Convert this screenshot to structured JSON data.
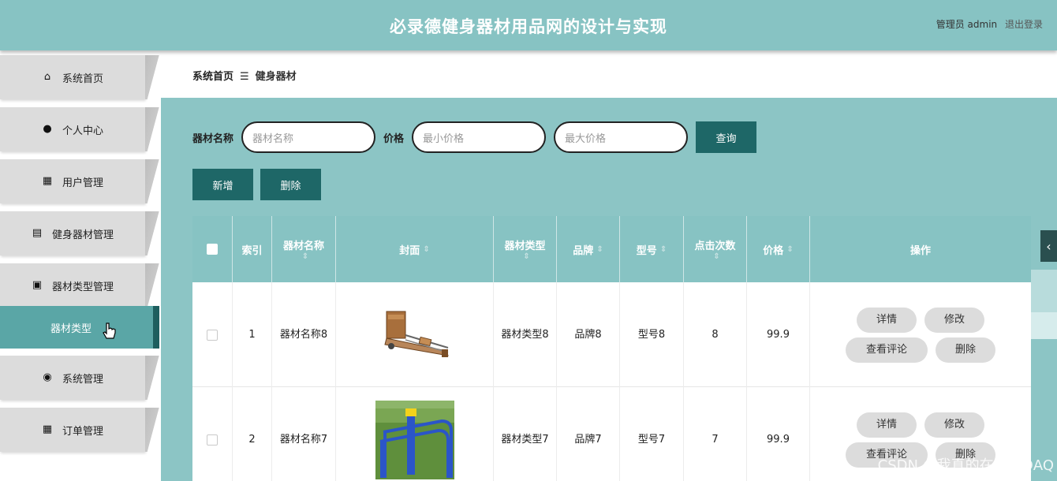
{
  "header": {
    "title": "必录德健身器材用品网的设计与实现",
    "role": "管理员 admin",
    "logout": "退出登录"
  },
  "sidebar": {
    "items": [
      {
        "label": "系统首页",
        "icon": "home-icon",
        "glyph": "⌂"
      },
      {
        "label": "个人中心",
        "icon": "person-icon",
        "glyph": "●"
      },
      {
        "label": "用户管理",
        "icon": "grid-icon",
        "glyph": "▦"
      },
      {
        "label": "健身器材管理",
        "icon": "chat-icon",
        "glyph": "▤"
      },
      {
        "label": "器材类型管理",
        "icon": "clipboard-icon",
        "glyph": "▣"
      },
      {
        "label": "系统管理",
        "icon": "bulb-icon",
        "glyph": "◉"
      },
      {
        "label": "订单管理",
        "icon": "grid-icon",
        "glyph": "▦"
      }
    ],
    "active_sub": "器材类型"
  },
  "breadcrumb": {
    "home": "系统首页",
    "separator": "☰",
    "current": "健身器材"
  },
  "search": {
    "name_label": "器材名称",
    "name_placeholder": "器材名称",
    "price_label": "价格",
    "min_placeholder": "最小价格",
    "max_placeholder": "最大价格",
    "query_button": "查询"
  },
  "actions": {
    "add": "新增",
    "delete": "删除"
  },
  "table": {
    "headers": {
      "index": "索引",
      "name": "器材名称",
      "cover": "封面",
      "type": "器材类型",
      "brand": "品牌",
      "model": "型号",
      "clicks": "点击次数",
      "price": "价格",
      "ops": "操作"
    },
    "rows": [
      {
        "index": "1",
        "name": "器材名称8",
        "type": "器材类型8",
        "brand": "品牌8",
        "model": "型号8",
        "clicks": "8",
        "price": "99.9"
      },
      {
        "index": "2",
        "name": "器材名称7",
        "type": "器材类型7",
        "brand": "品牌7",
        "model": "型号7",
        "clicks": "7",
        "price": "99.9"
      }
    ],
    "op_labels": {
      "detail": "详情",
      "edit": "修改",
      "comments": "查看评论",
      "delete": "删除"
    }
  },
  "watermark": "CSDN @我真的在拉扯QAQ",
  "colors": {
    "accent": "#87c3c3",
    "dark": "#1e6767"
  }
}
